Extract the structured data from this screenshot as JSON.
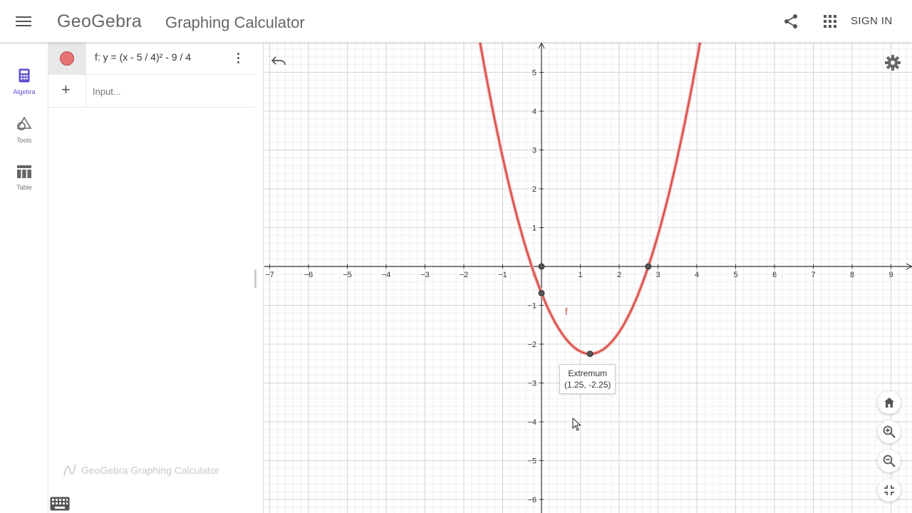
{
  "header": {
    "logo": "GeoGebra",
    "app_title": "Graphing Calculator",
    "sign_in": "SIGN IN"
  },
  "rail": {
    "items": [
      {
        "label": "Algebra",
        "icon": "calculator-icon",
        "active": true
      },
      {
        "label": "Tools",
        "icon": "shapes-icon",
        "active": false
      },
      {
        "label": "Table",
        "icon": "table-icon",
        "active": false
      }
    ]
  },
  "algebra": {
    "object_name": "f",
    "formula": "f: y = (x - 5 / 4)² - 9 / 4",
    "input_placeholder": "Input...",
    "color": "#e57373",
    "watermark": "GeoGebra Graphing Calculator"
  },
  "graph": {
    "x_range": [
      -7.2,
      9.5
    ],
    "y_range": [
      -6.3,
      5.8
    ],
    "x_ticks": [
      "−7",
      "−6",
      "−5",
      "−4",
      "−3",
      "−2",
      "−1",
      "0",
      "1",
      "2",
      "3",
      "4",
      "5",
      "6",
      "7",
      "8",
      "9"
    ],
    "y_ticks": [
      "5",
      "4",
      "3",
      "2",
      "1",
      "−1",
      "−2",
      "−3",
      "−4",
      "−5",
      "−6"
    ],
    "function_label": "f",
    "curve_color": "#d9534f",
    "points": [
      {
        "x": 0,
        "y": 0
      },
      {
        "x": 2.75,
        "y": 0
      },
      {
        "x": 0,
        "y": -0.6875
      },
      {
        "x": 1.25,
        "y": -2.25
      }
    ],
    "tooltip": {
      "title": "Extremum",
      "coords": "(1.25, -2.25)"
    }
  }
}
